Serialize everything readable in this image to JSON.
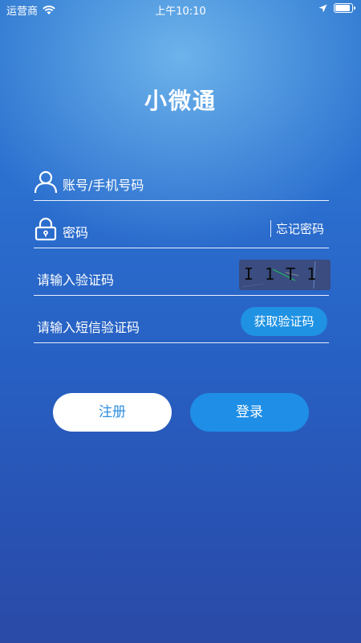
{
  "status_bar": {
    "carrier": "运营商",
    "time": "上午10:10"
  },
  "app": {
    "title": "小微通"
  },
  "form": {
    "account_placeholder": "账号/手机号码",
    "password_placeholder": "密码",
    "forgot_password": "忘记密码",
    "captcha_placeholder": "请输入验证码",
    "captcha_text": "I1T1",
    "sms_code_placeholder": "请输入短信验证码",
    "get_sms_code_button": "获取验证码"
  },
  "actions": {
    "register_label": "注册",
    "login_label": "登录"
  }
}
